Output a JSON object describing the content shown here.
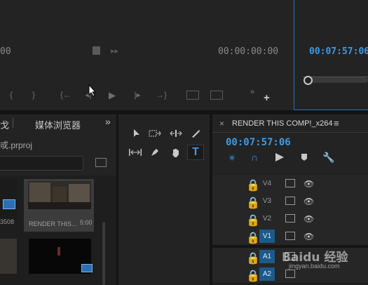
{
  "source_monitor": {
    "timecode": "00:00:00:00",
    "timecode_left_partial": "00"
  },
  "program_monitor": {
    "timecode": "00:07:57:06"
  },
  "project_panel": {
    "tab_partial": "戈",
    "tab_media_browser": "媒体浏览器",
    "project_file_partial": "戓.prproj",
    "clip1_name": "RENDER THIS...",
    "clip1_duration": "5:00",
    "clip0_partial_duration": "3508"
  },
  "timeline": {
    "close_glyph": "×",
    "sequence_name": "RENDER THIS COMP!_x264",
    "menu_glyph": "≡",
    "timecode": "00:07:57:06",
    "tracks": [
      {
        "label": "V4",
        "active": false
      },
      {
        "label": "V3",
        "active": false
      },
      {
        "label": "V2",
        "active": false
      },
      {
        "label": "V1",
        "active": true
      },
      {
        "label": "A1",
        "active": true
      },
      {
        "label": "A2",
        "active": true
      }
    ]
  },
  "watermark": {
    "text": "Baidu 经验",
    "url": "jingyan.baidu.com"
  },
  "colors": {
    "accent": "#3d9ae8",
    "track_active": "#1c5a8c",
    "panel_bg": "#232323"
  }
}
